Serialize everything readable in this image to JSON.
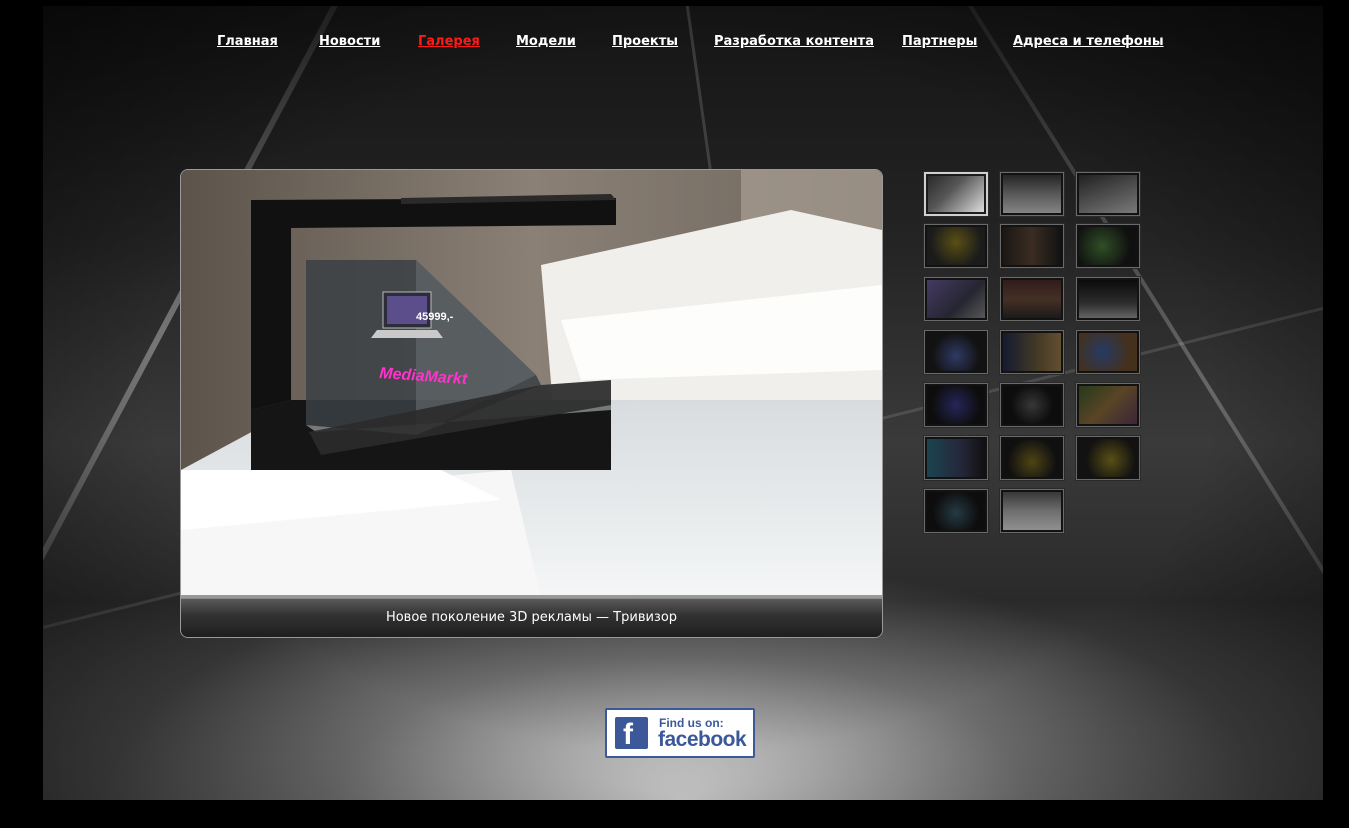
{
  "nav": {
    "items": [
      {
        "label": "Главная"
      },
      {
        "label": "Новости"
      },
      {
        "label": "Галерея",
        "active": true
      },
      {
        "label": "Модели"
      },
      {
        "label": "Проекты"
      },
      {
        "label": "Разработка контента"
      },
      {
        "label": "Партнеры"
      },
      {
        "label": "Адреса и телефоны"
      }
    ],
    "active_color": "#ff1a1a",
    "color": "#ffffff"
  },
  "viewer": {
    "caption": "Новое поколение 3D рекламы — Тривизор",
    "photo": {
      "price_text": "45999,-",
      "brand_text": "MediaMarkt"
    }
  },
  "gallery": {
    "thumbnail_count": 20,
    "selected_index": 0
  },
  "facebook": {
    "icon": "facebook-f-icon",
    "find_text": "Find us on:",
    "brand_text": "facebook",
    "color": "#3b5998"
  }
}
